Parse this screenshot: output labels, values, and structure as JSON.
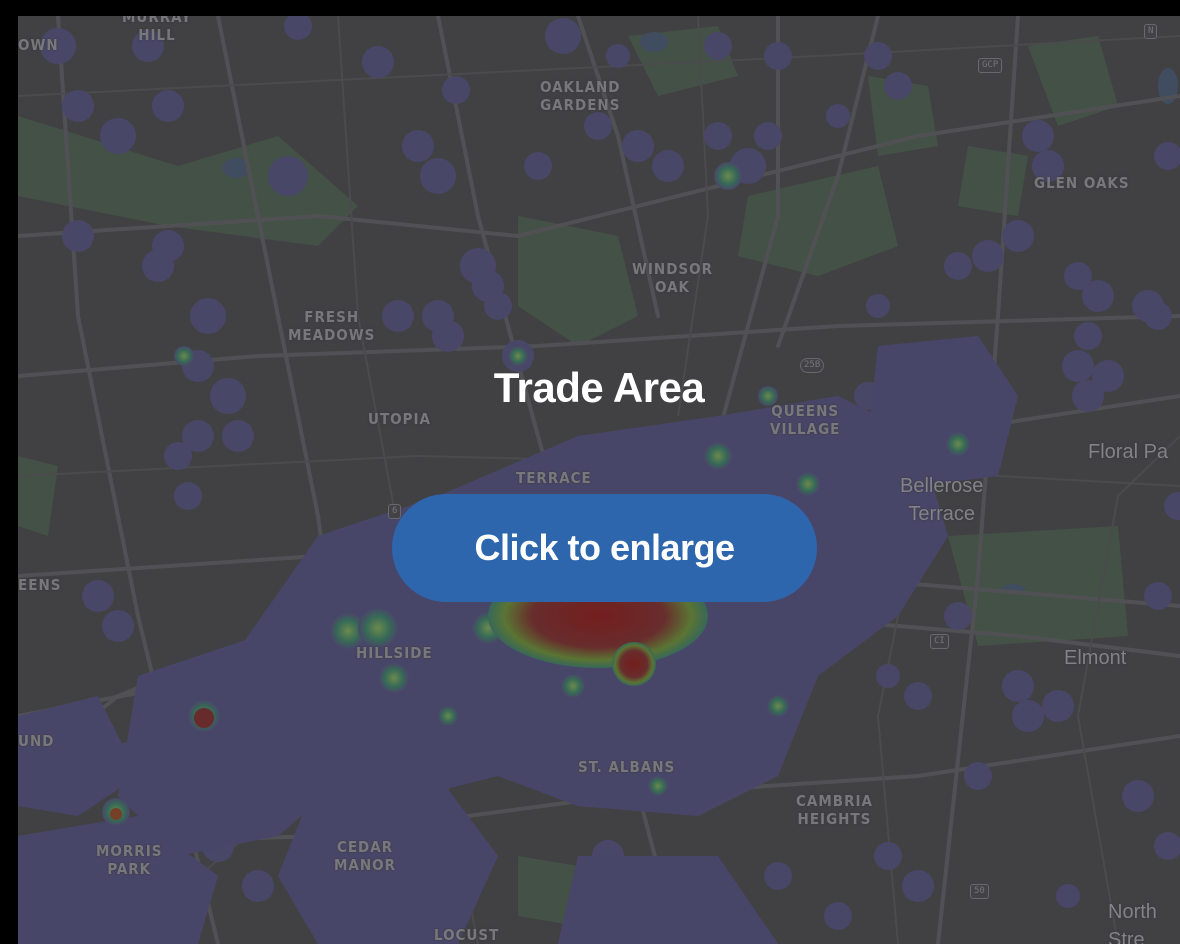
{
  "overlay": {
    "title": "Trade Area",
    "button_label": "Click to enlarge"
  },
  "map": {
    "neighborhoods": [
      {
        "id": "oakland-gardens",
        "label": "OAKLAND\nGARDENS"
      },
      {
        "id": "glen-oaks",
        "label": "GLEN OAKS"
      },
      {
        "id": "windsor-oak",
        "label": "WINDSOR\nOAK"
      },
      {
        "id": "fresh-meadows",
        "label": "FRESH\nMEADOWS"
      },
      {
        "id": "utopia",
        "label": "UTOPIA"
      },
      {
        "id": "queens-village",
        "label": "QUEENS\nVILLAGE"
      },
      {
        "id": "terrace",
        "label": "TERRACE"
      },
      {
        "id": "hillside",
        "label": "HILLSIDE"
      },
      {
        "id": "st-albans",
        "label": "ST. ALBANS"
      },
      {
        "id": "cambria-heights",
        "label": "CAMBRIA\nHEIGHTS"
      },
      {
        "id": "cedar-manor",
        "label": "CEDAR\nMANOR"
      },
      {
        "id": "morris-park",
        "label": "MORRIS\nPARK"
      },
      {
        "id": "locust",
        "label": "LOCUST"
      },
      {
        "id": "murray-hill",
        "label": "MURRAY\nHILL"
      },
      {
        "id": "town",
        "label": "OWN"
      },
      {
        "id": "eens",
        "label": "EENS"
      },
      {
        "id": "und",
        "label": "UND"
      }
    ],
    "cities": [
      {
        "id": "bellerose-terrace",
        "label": "Bellerose\nTerrace"
      },
      {
        "id": "floral-park",
        "label": "Floral Pa"
      },
      {
        "id": "elmont",
        "label": "Elmont"
      },
      {
        "id": "north",
        "label": "North\nStre"
      }
    ],
    "shields": [
      {
        "id": "gcp",
        "label": "GCP"
      },
      {
        "id": "ni",
        "label": "N"
      },
      {
        "id": "r25b",
        "label": "25B"
      },
      {
        "id": "ci",
        "label": "CI"
      },
      {
        "id": "r50",
        "label": "50"
      },
      {
        "id": "r6",
        "label": "6"
      }
    ],
    "colors": {
      "background": "#4a4a4d",
      "park": "#4f5e50",
      "road": "#5e5e62",
      "heat_low": "#55527a",
      "heat_mid": "#3f7f67",
      "heat_high": "#7a3030",
      "button": "#2d66ad"
    }
  }
}
